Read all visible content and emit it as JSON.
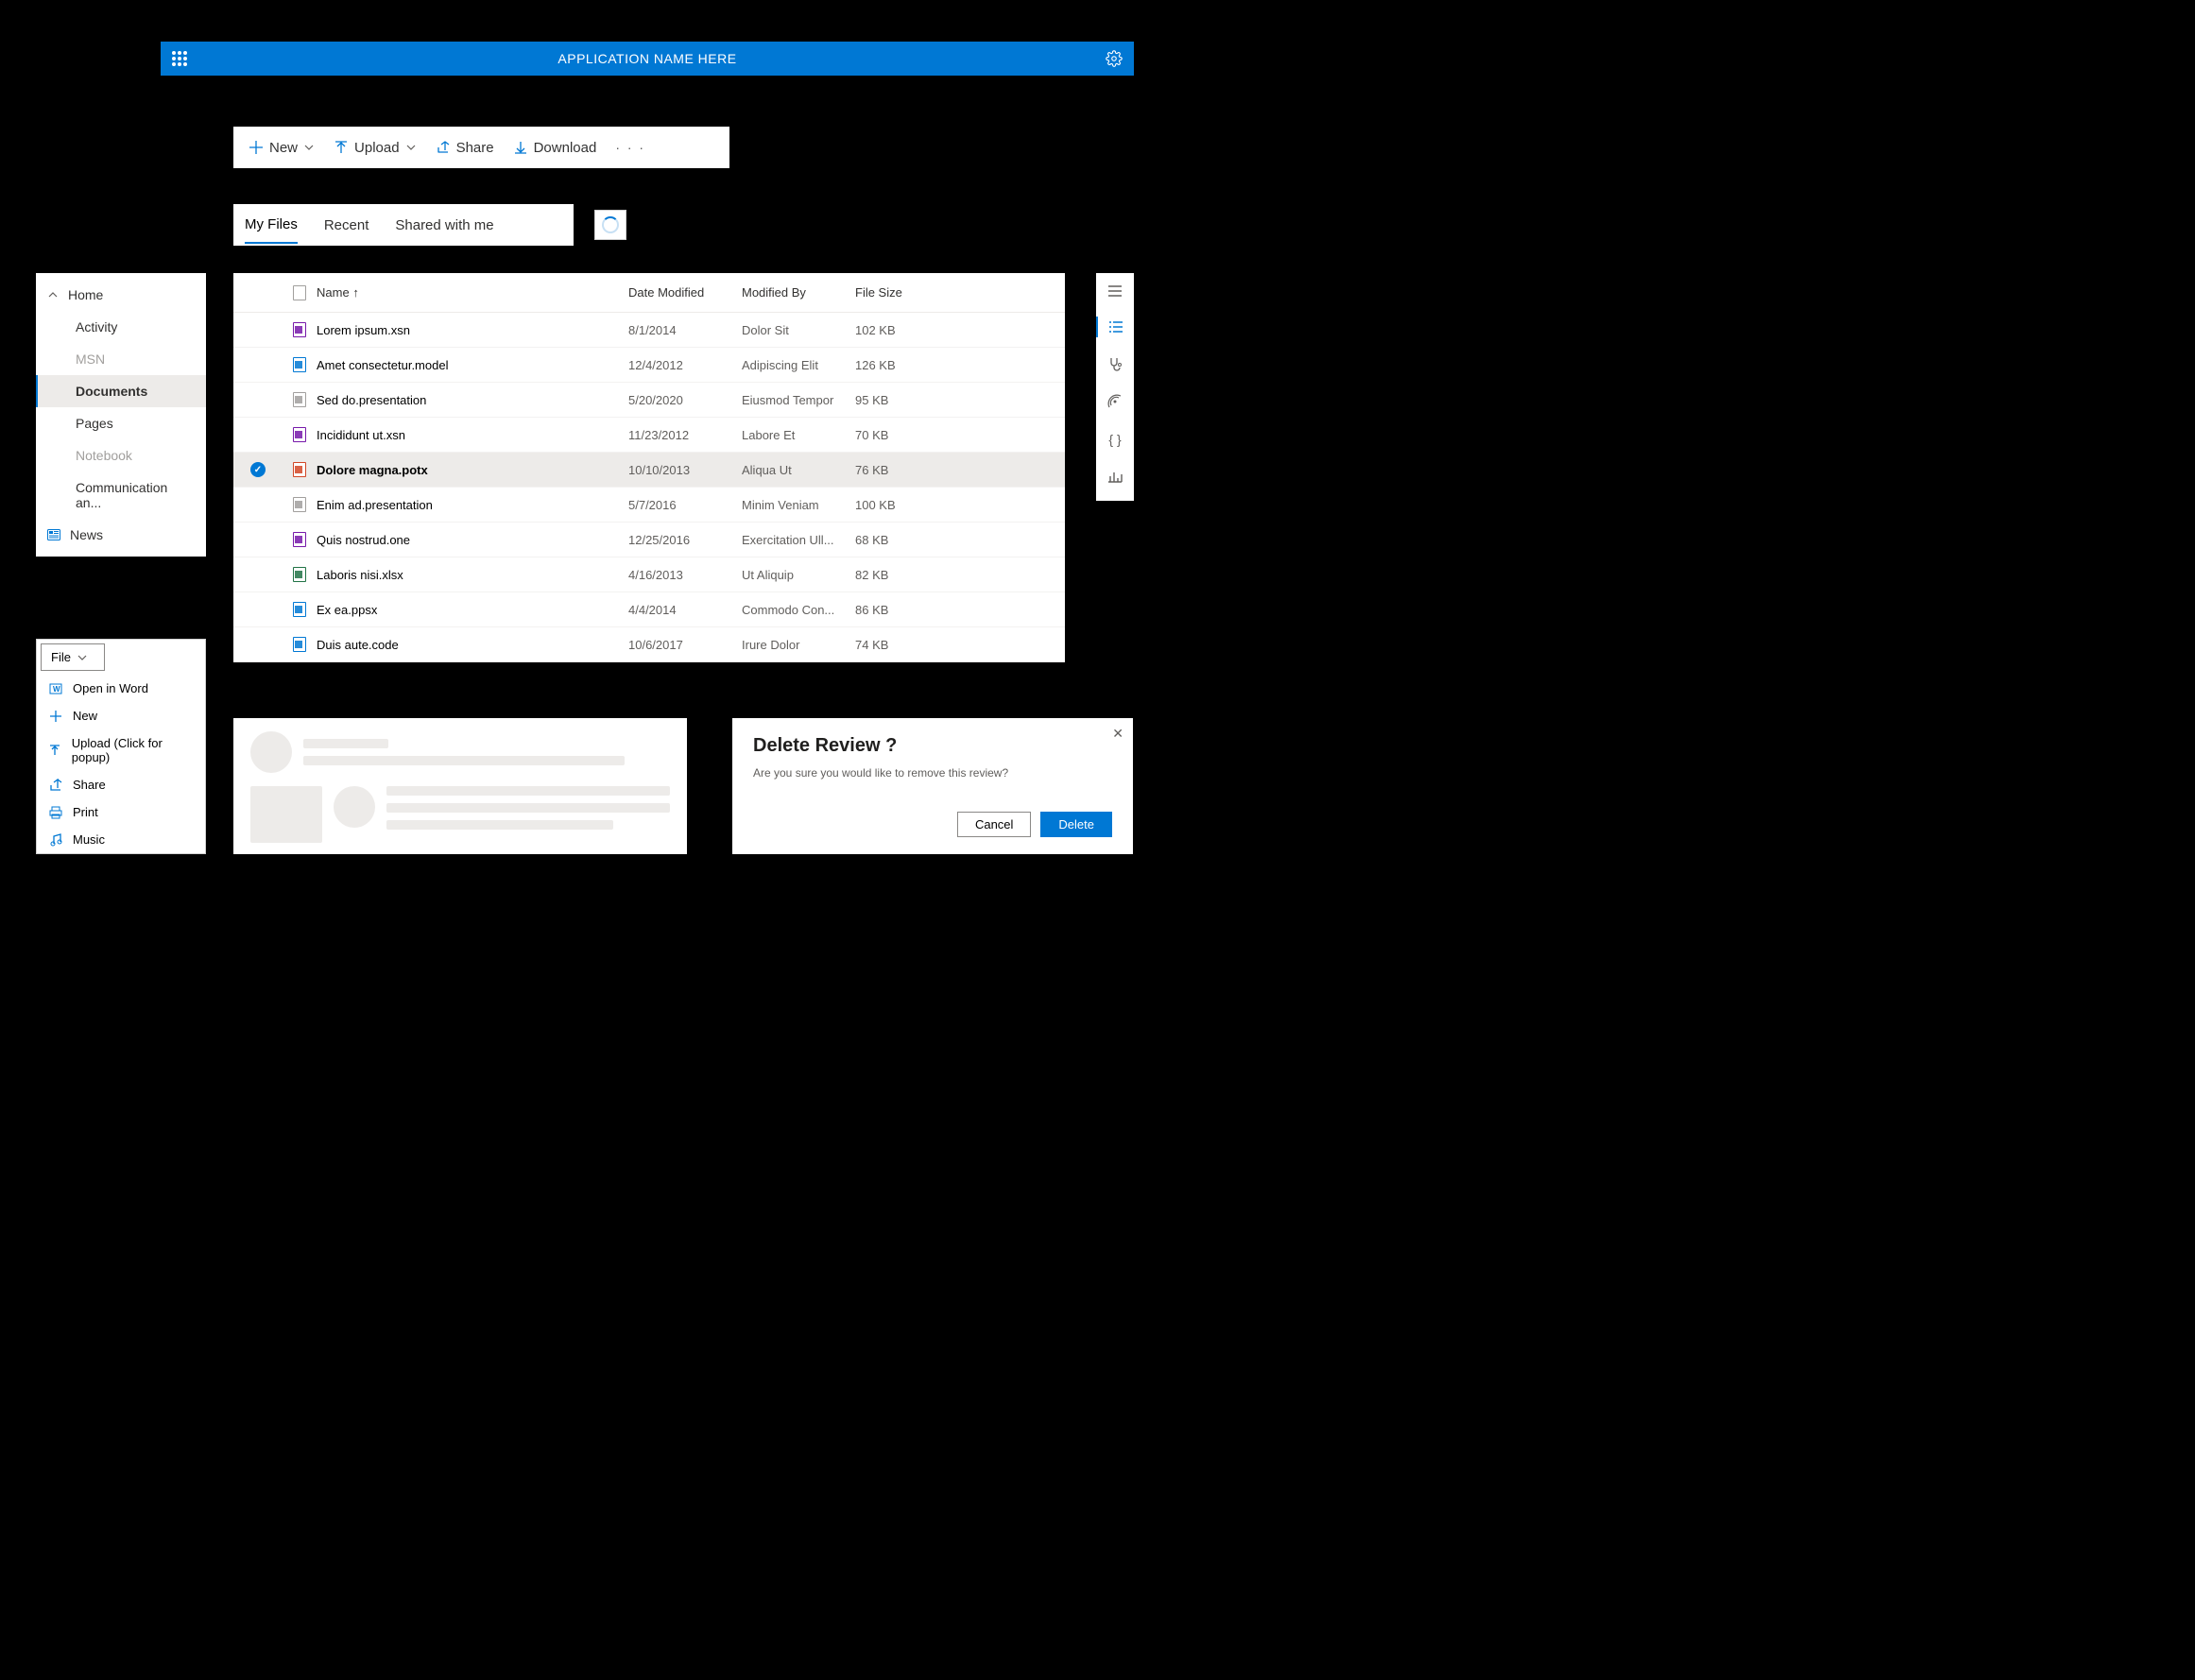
{
  "header": {
    "title": "APPLICATION NAME HERE"
  },
  "commands": {
    "new": "New",
    "upload": "Upload",
    "share": "Share",
    "download": "Download"
  },
  "tabs": [
    {
      "label": "My Files",
      "active": true
    },
    {
      "label": "Recent",
      "active": false
    },
    {
      "label": "Shared with me",
      "active": false
    }
  ],
  "left_nav": {
    "home": "Home",
    "items": [
      {
        "label": "Activity",
        "disabled": false
      },
      {
        "label": "MSN",
        "disabled": true
      },
      {
        "label": "Documents",
        "selected": true
      },
      {
        "label": "Pages",
        "disabled": false
      },
      {
        "label": "Notebook",
        "disabled": true
      },
      {
        "label": "Communication an...",
        "disabled": false
      }
    ],
    "news": "News"
  },
  "file_menu": {
    "button": "File",
    "items": [
      {
        "label": "Open in Word",
        "icon": "word"
      },
      {
        "label": "New",
        "icon": "plus"
      },
      {
        "label": "Upload (Click for popup)",
        "icon": "upload"
      },
      {
        "label": "Share",
        "icon": "share"
      },
      {
        "label": "Print",
        "icon": "print"
      },
      {
        "label": "Music",
        "icon": "music"
      }
    ]
  },
  "table": {
    "columns": {
      "name": "Name",
      "date": "Date Modified",
      "by": "Modified By",
      "size": "File Size"
    },
    "rows": [
      {
        "icon": "xsn",
        "color": "#7719aa",
        "name": "Lorem ipsum.xsn",
        "date": "8/1/2014",
        "by": "Dolor Sit",
        "size": "102 KB",
        "selected": false
      },
      {
        "icon": "model",
        "color": "#0078d4",
        "name": "Amet consectetur.model",
        "date": "12/4/2012",
        "by": "Adipiscing Elit",
        "size": "126 KB",
        "selected": false
      },
      {
        "icon": "pres",
        "color": "#a19f9d",
        "name": "Sed do.presentation",
        "date": "5/20/2020",
        "by": "Eiusmod Tempor",
        "size": "95 KB",
        "selected": false
      },
      {
        "icon": "xsn",
        "color": "#7719aa",
        "name": "Incididunt ut.xsn",
        "date": "11/23/2012",
        "by": "Labore Et",
        "size": "70 KB",
        "selected": false
      },
      {
        "icon": "potx",
        "color": "#d24726",
        "name": "Dolore magna.potx",
        "date": "10/10/2013",
        "by": "Aliqua Ut",
        "size": "76 KB",
        "selected": true
      },
      {
        "icon": "pres",
        "color": "#a19f9d",
        "name": "Enim ad.presentation",
        "date": "5/7/2016",
        "by": "Minim Veniam",
        "size": "100 KB",
        "selected": false
      },
      {
        "icon": "one",
        "color": "#7719aa",
        "name": "Quis nostrud.one",
        "date": "12/25/2016",
        "by": "Exercitation Ull...",
        "size": "68 KB",
        "selected": false
      },
      {
        "icon": "xlsx",
        "color": "#217346",
        "name": "Laboris nisi.xlsx",
        "date": "4/16/2013",
        "by": "Ut Aliquip",
        "size": "82 KB",
        "selected": false
      },
      {
        "icon": "ppsx",
        "color": "#0078d4",
        "name": "Ex ea.ppsx",
        "date": "4/4/2014",
        "by": "Commodo Con...",
        "size": "86 KB",
        "selected": false
      },
      {
        "icon": "code",
        "color": "#0078d4",
        "name": "Duis aute.code",
        "date": "10/6/2017",
        "by": "Irure Dolor",
        "size": "74 KB",
        "selected": false
      }
    ]
  },
  "dialog": {
    "title": "Delete Review ?",
    "body": "Are you sure you would like to remove this review?",
    "cancel": "Cancel",
    "confirm": "Delete"
  }
}
